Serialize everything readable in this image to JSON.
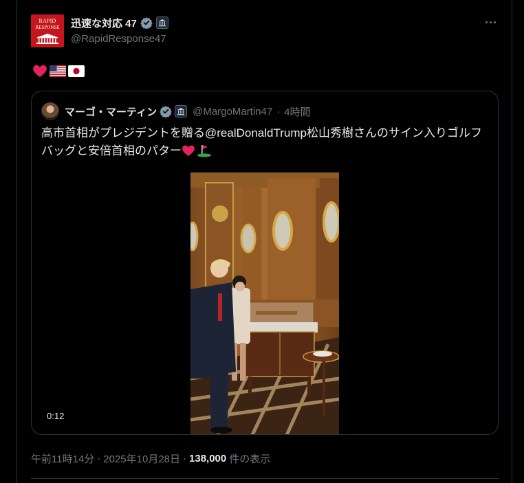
{
  "post": {
    "author_name": "迅速な対応 47",
    "author_handle": "@RapidResponse47",
    "avatar_text_top": "RAPID",
    "avatar_text_bottom": "RESPONSE",
    "text_emojis": [
      "heart-emoji",
      "us-flag-emoji",
      "japan-flag-emoji"
    ],
    "timestamp": "午前11時14分",
    "separator1": "·",
    "date": "2025年10月28日",
    "separator2": "·",
    "views_count": "138,000",
    "views_label": "件の表示"
  },
  "quote": {
    "author_name": "マーゴ・マーティン",
    "author_handle": "@MargoMartin47",
    "separator": "·",
    "time_ago": "4時間",
    "text": "高市首相がプレジデントを贈る@realDonaldTrump松山秀樹さんのサイン入りゴルフバッグと安倍首相のパター",
    "video_duration": "0:12"
  },
  "colors": {
    "background": "#000000",
    "text_primary": "#e7e9ea",
    "text_secondary": "#71767b",
    "border": "#2f3336",
    "verified_blue": "#1d9bf0",
    "avatar_red": "#c4161c"
  }
}
